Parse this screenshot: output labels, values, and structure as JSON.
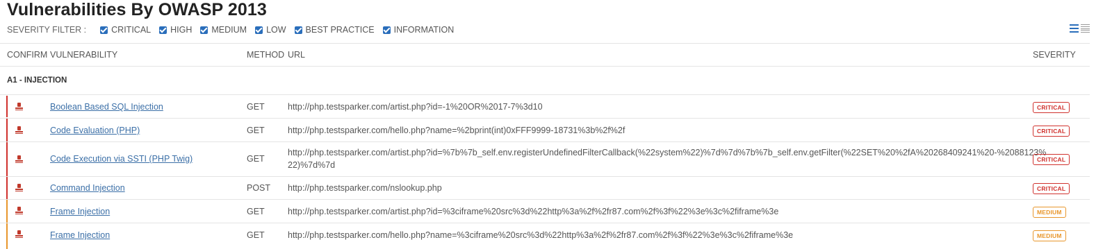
{
  "title": "Vulnerabilities By OWASP 2013",
  "filter": {
    "label": "SEVERITY FILTER :",
    "options": [
      "CRITICAL",
      "HIGH",
      "MEDIUM",
      "LOW",
      "BEST PRACTICE",
      "INFORMATION"
    ]
  },
  "table": {
    "headers": {
      "confirm": "CONFIRM",
      "vulnerability": "VULNERABILITY",
      "method": "METHOD",
      "url": "URL",
      "severity": "SEVERITY"
    },
    "group": "A1 - INJECTION",
    "rows": [
      {
        "name": "Boolean Based SQL Injection",
        "method": "GET",
        "url": "http://php.testsparker.com/artist.php?id=-1%20OR%2017-7%3d10",
        "url2": "",
        "severity": "CRITICAL",
        "color": "#d0312d"
      },
      {
        "name": "Code Evaluation (PHP)",
        "method": "GET",
        "url": "http://php.testsparker.com/hello.php?name=%2bprint(int)0xFFF9999-18731%3b%2f%2f",
        "url2": "",
        "severity": "CRITICAL",
        "color": "#d0312d"
      },
      {
        "name": "Code Execution via SSTI (PHP Twig)",
        "method": "GET",
        "url": "http://php.testsparker.com/artist.php?id=%7b%7b_self.env.registerUndefinedFilterCallback(%22system%22)%7d%7d%7b%7b_self.env.getFilter(%22SET%20%2fA%20268409241%20-%2088123%",
        "url2": "22)%7d%7d",
        "severity": "CRITICAL",
        "color": "#d0312d"
      },
      {
        "name": "Command Injection",
        "method": "POST",
        "url": "http://php.testsparker.com/nslookup.php",
        "url2": "",
        "severity": "CRITICAL",
        "color": "#d0312d"
      },
      {
        "name": "Frame Injection",
        "method": "GET",
        "url": "http://php.testsparker.com/artist.php?id=%3ciframe%20src%3d%22http%3a%2f%2fr87.com%2f%3f%22%3e%3c%2fiframe%3e",
        "url2": "",
        "severity": "MEDIUM",
        "color": "#e8962b"
      },
      {
        "name": "Frame Injection",
        "method": "GET",
        "url": "http://php.testsparker.com/hello.php?name=%3ciframe%20src%3d%22http%3a%2f%2fr87.com%2f%3f%22%3e%3c%2fiframe%3e",
        "url2": "",
        "severity": "MEDIUM",
        "color": "#e8962b"
      }
    ]
  },
  "icons": {
    "checkbox": "checkbox-checked-icon",
    "confirm": "stamp-icon",
    "list_view": "list-view-icon",
    "compact_view": "compact-list-icon"
  },
  "colors": {
    "critical": "#d0312d",
    "medium": "#e8962b",
    "link": "#3b6fa7",
    "checkbox": "#2a6ebb"
  }
}
